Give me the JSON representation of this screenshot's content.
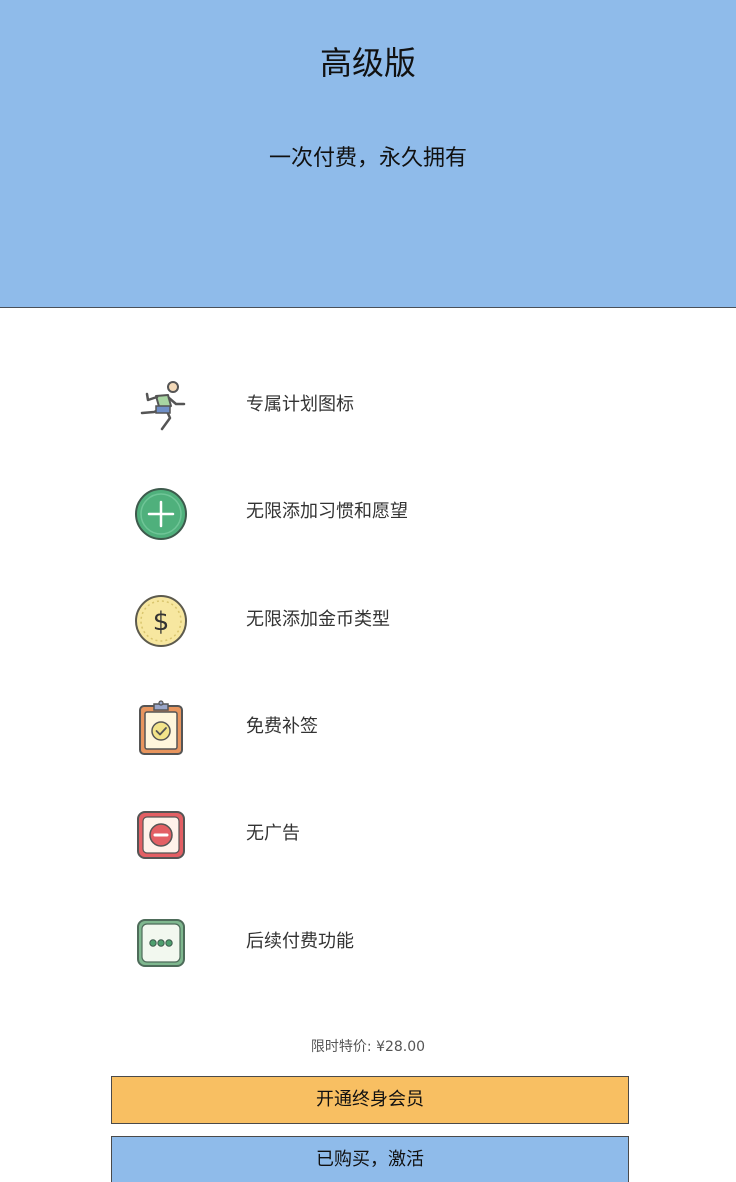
{
  "header": {
    "title": "高级版",
    "subtitle": "一次付费，永久拥有",
    "background": "#8fbbea"
  },
  "features": [
    {
      "icon": "running-person-icon",
      "label": "专属计划图标"
    },
    {
      "icon": "plus-circle-icon",
      "label": "无限添加习惯和愿望"
    },
    {
      "icon": "dollar-coin-icon",
      "label": "无限添加金币类型"
    },
    {
      "icon": "clipboard-check-icon",
      "label": "免费补签"
    },
    {
      "icon": "minus-block-icon",
      "label": "无广告"
    },
    {
      "icon": "more-dots-icon",
      "label": "后续付费功能"
    }
  ],
  "price": {
    "text": "限时特价: ¥28.00"
  },
  "buttons": {
    "buy_label": "开通终身会员",
    "buy_color": "#f8bf62",
    "activate_label": "已购买，激活",
    "activate_color": "#8fbbea"
  }
}
